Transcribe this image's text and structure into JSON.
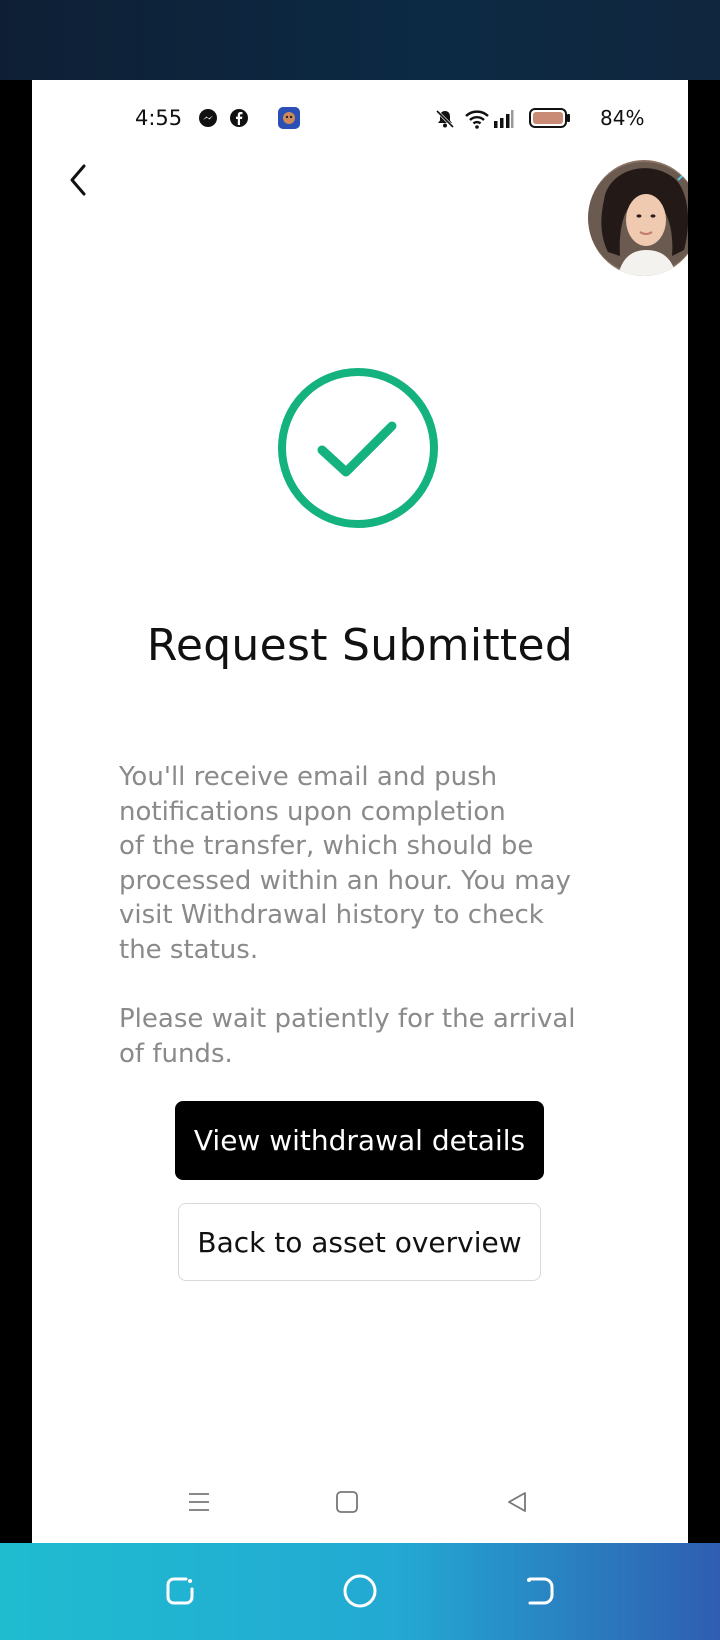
{
  "status_bar": {
    "time": "4:55",
    "battery_percent": "84%",
    "left_icons": [
      "messenger-icon",
      "facebook-icon",
      "app-badge-icon"
    ],
    "right_icons": [
      "bell-off-icon",
      "wifi-icon",
      "signal-icon",
      "battery-icon"
    ]
  },
  "header": {
    "back_icon": "chevron-left-icon",
    "avatar": "user-avatar"
  },
  "result": {
    "icon": "check-circle-icon",
    "accent_color": "#13b27f",
    "title": "Request Submitted",
    "paragraph_1_lines": [
      "You'll receive email and push",
      "notifications upon completion",
      "of the transfer, which should be",
      "processed within an hour. You may",
      "visit Withdrawal history to check",
      "the status."
    ],
    "paragraph_2_lines": [
      "Please wait patiently for the arrival",
      "of funds."
    ]
  },
  "actions": {
    "primary_label": "View withdrawal details",
    "secondary_label": "Back to asset overview"
  },
  "in_app_nav": {
    "icons": [
      "menu-icon",
      "home-square-icon",
      "back-triangle-icon"
    ]
  },
  "system_nav": {
    "icons": [
      "recents-icon",
      "home-circle-icon",
      "back-icon"
    ]
  }
}
